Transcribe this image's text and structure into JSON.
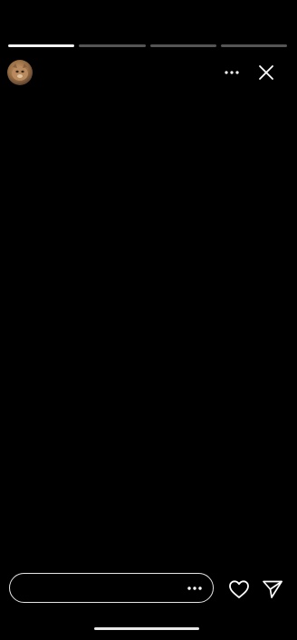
{
  "story": {
    "segment_progress": [
      1.0,
      0.0,
      0.0,
      0.0
    ]
  },
  "header": {
    "avatar_icon": "profile-avatar",
    "more_icon": "more-horizontal-icon",
    "close_icon": "close-icon"
  },
  "footer": {
    "reply_value": "",
    "reply_placeholder": "",
    "more_icon": "more-horizontal-icon",
    "like_icon": "heart-icon",
    "send_icon": "send-icon"
  },
  "colors": {
    "background": "#000000",
    "progress_active": "#f2f2f2",
    "progress_inactive": "#555555",
    "icon": "#ffffff"
  }
}
